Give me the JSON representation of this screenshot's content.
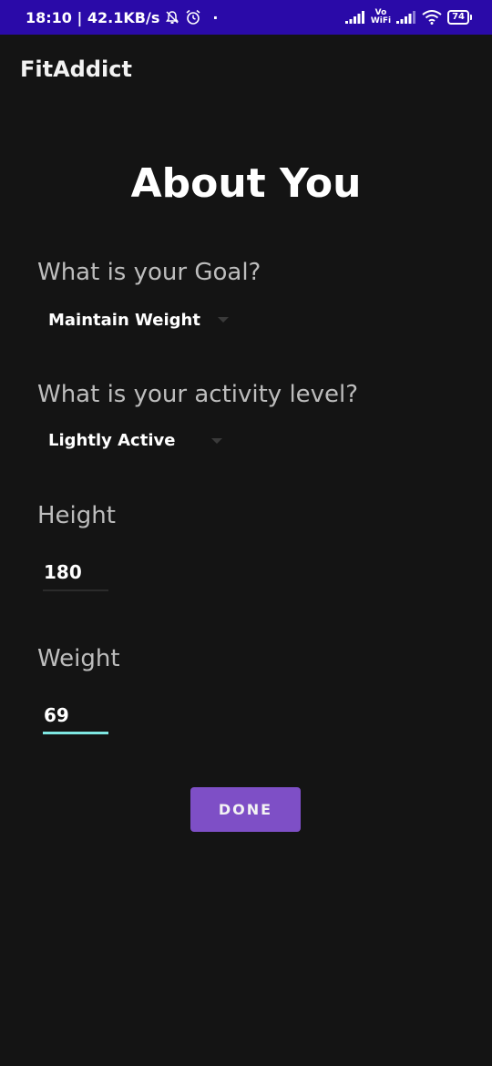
{
  "status_bar": {
    "time_speed": "18:10 | 42.1KB/s",
    "dot": "·",
    "vowifi_top": "Vo",
    "vowifi_bottom": "WiFi",
    "battery": "74",
    "icons": [
      "mute-bell-icon",
      "alarm-icon",
      "signal-icon",
      "vowifi-icon",
      "signal-icon",
      "wifi-icon",
      "battery-icon"
    ]
  },
  "app_bar": {
    "title": "FitAddict"
  },
  "page": {
    "title": "About You"
  },
  "goal": {
    "label": "What is your Goal?",
    "selected": "Maintain Weight"
  },
  "activity": {
    "label": "What is your activity level?",
    "selected": "Lightly Active"
  },
  "height": {
    "label": "Height",
    "value": "180"
  },
  "weight": {
    "label": "Weight",
    "value": "69"
  },
  "actions": {
    "done_label": "DONE"
  },
  "colors": {
    "status_bar": "#2a0aa8",
    "background": "#141414",
    "accent_button": "#7e4fc6",
    "focus_underline": "#7ee7e2"
  }
}
